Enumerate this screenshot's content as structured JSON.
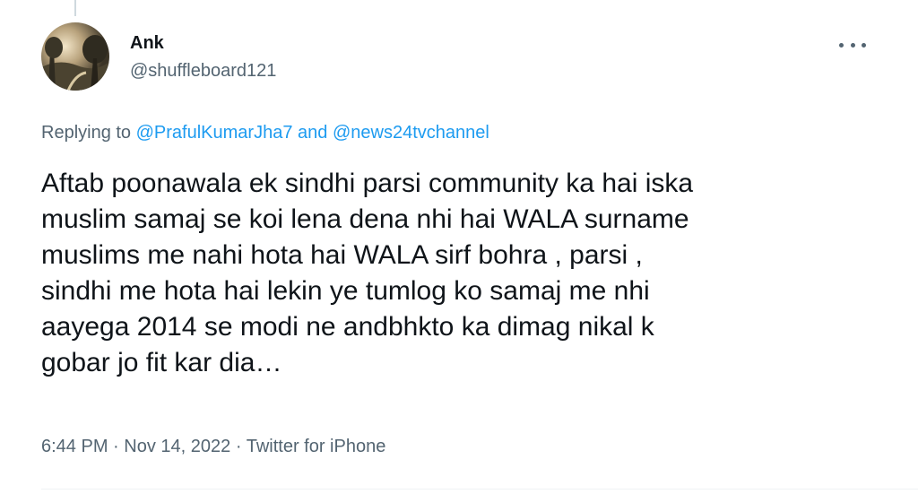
{
  "author": {
    "display_name": "Ank",
    "handle": "@shuffleboard121"
  },
  "reply": {
    "prefix": "Replying to",
    "mentions": [
      "@PrafulKumarJha7",
      "@news24tvchannel"
    ],
    "conjunction": "and"
  },
  "tweet": {
    "lines": [
      "Aftab poonawala ek sindhi parsi community ka hai iska",
      "muslim samaj se koi lena dena nhi hai WALA surname",
      "muslims me nahi hota hai WALA sirf bohra , parsi ,",
      "sindhi me hota hai lekin ye tumlog ko samaj me nhi",
      "aayega 2014 se modi ne andbhkto ka dimag nikal k",
      "gobar jo fit kar dia…"
    ]
  },
  "meta": {
    "time": "6:44 PM",
    "date": "Nov 14, 2022",
    "source": "Twitter for iPhone",
    "separator": "·"
  },
  "colors": {
    "link": "#1d9bf0",
    "secondary_text": "#536471",
    "primary_text": "#0f1419"
  },
  "icons": {
    "more": "more-icon"
  }
}
